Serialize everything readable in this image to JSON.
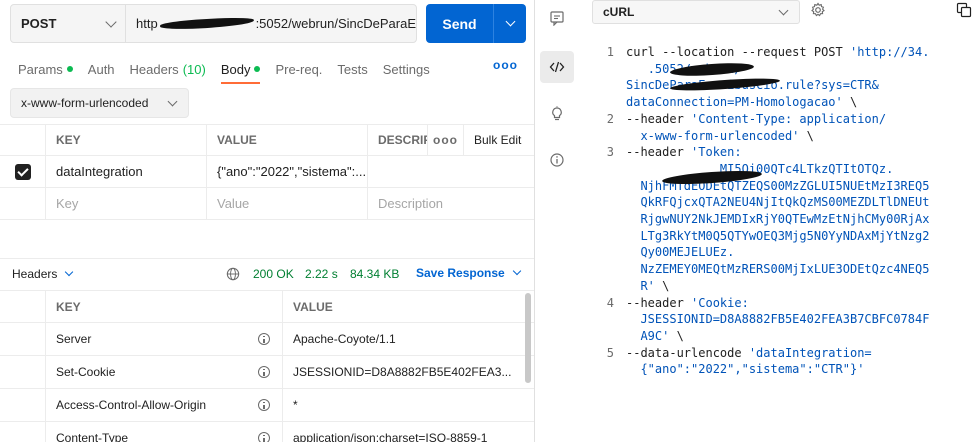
{
  "request": {
    "method": "POST",
    "url_visible": "http",
    "url_tail": ":5052/webrun/SincDeParaE",
    "send_label": "Send"
  },
  "tabs": [
    {
      "label": "Params",
      "dot": true
    },
    {
      "label": "Auth"
    },
    {
      "label": "Headers",
      "count": "(10)"
    },
    {
      "label": "Body",
      "dot": true,
      "active": true
    },
    {
      "label": "Pre-req."
    },
    {
      "label": "Tests"
    },
    {
      "label": "Settings"
    }
  ],
  "tabs_more": "ooo",
  "body_type": "x-www-form-urlencoded",
  "params": {
    "headers": {
      "key": "KEY",
      "value": "VALUE",
      "desc": "DESCRIP",
      "more": "ooo",
      "bulk": "Bulk Edit"
    },
    "rows": [
      {
        "key": "dataIntegration",
        "value": "{\"ano\":\"2022\",\"sistema\":..."
      }
    ],
    "placeholder": {
      "key": "Key",
      "value": "Value",
      "desc": "Description"
    }
  },
  "response": {
    "tab_label": "Headers",
    "status": "200 OK",
    "time": "2.22 s",
    "size": "84.34 KB",
    "save_label": "Save Response",
    "headers": {
      "key": "KEY",
      "value": "VALUE"
    },
    "rows": [
      {
        "key": "Server",
        "value": "Apache-Coyote/1.1"
      },
      {
        "key": "Set-Cookie",
        "value": "JSESSIONID=D8A8882FB5E402FEA3..."
      },
      {
        "key": "Access-Control-Allow-Origin",
        "value": "*"
      },
      {
        "key": "Content-Type",
        "value": "application/json;charset=ISO-8859-1"
      }
    ]
  },
  "snippet": {
    "language": "cURL",
    "lines": [
      {
        "num": "1",
        "segs": [
          {
            "t": "curl --location --request POST ",
            "c": "plain"
          },
          {
            "t": "'http://34.",
            "c": "str"
          },
          {
            "t": "\n   .5052/webrun/",
            "c": "str"
          },
          {
            "t": "\nSincDeParaEscribuscio.rule?sys=CTR&",
            "c": "str"
          },
          {
            "t": "\ndataConnection=PM-Homologacao'",
            "c": "str"
          },
          {
            "t": " \\",
            "c": "plain"
          }
        ]
      },
      {
        "num": "2",
        "segs": [
          {
            "t": "--header ",
            "c": "plain"
          },
          {
            "t": "'Content-Type: application/\n  x-www-form-urlencoded'",
            "c": "str"
          },
          {
            "t": " \\",
            "c": "plain"
          }
        ]
      },
      {
        "num": "3",
        "segs": [
          {
            "t": "--header ",
            "c": "plain"
          },
          {
            "t": "'Token:",
            "c": "str"
          },
          {
            "t": "\n             MI5Qi00QTc4LTkzQTItOTQz.\n  NjhFMTdEODEtQTZEQS00MzZGLUI5NUEtMzI3REQ5\n  QkRFQjcxQTA2NEU4NjItQkQzMS00MEZDLTlDNEUt\n  RjgwNUY2NkJEMDIxRjY0QTEwMzEtNjhCMy00RjAx\n  LTg3RkYtM0Q5QTYwOEQ3Mjg5N0YyNDAxMjYtNzg2\n  Qy00MEJELUEz.\n  NzZEMEY0MEQtMzRERS00MjIxLUE3ODEtQzc4NEQ5\n  R'",
            "c": "str"
          },
          {
            "t": " \\",
            "c": "plain"
          }
        ]
      },
      {
        "num": "4",
        "segs": [
          {
            "t": "--header ",
            "c": "plain"
          },
          {
            "t": "'Cookie:\n  JSESSIONID=D8A8882FB5E402FEA3B7CBFC0784F\n  A9C'",
            "c": "str"
          },
          {
            "t": " \\",
            "c": "plain"
          }
        ]
      },
      {
        "num": "5",
        "segs": [
          {
            "t": "--data-urlencode ",
            "c": "plain"
          },
          {
            "t": "'dataIntegration=\n  {\"ano\":\"2022\",\"sistema\":\"CTR\"}'",
            "c": "str"
          }
        ]
      }
    ]
  },
  "colors": {
    "send": "#0265d2",
    "active_tab": "#ff6c37",
    "status_ok": "#007f31",
    "dot": "#0cbb52",
    "code_string": "#0053b8"
  },
  "icons": [
    "comment-icon",
    "code-icon",
    "lightbulb-icon",
    "info-icon",
    "gear-icon",
    "copy-icon",
    "globe-icon",
    "check-icon"
  ]
}
